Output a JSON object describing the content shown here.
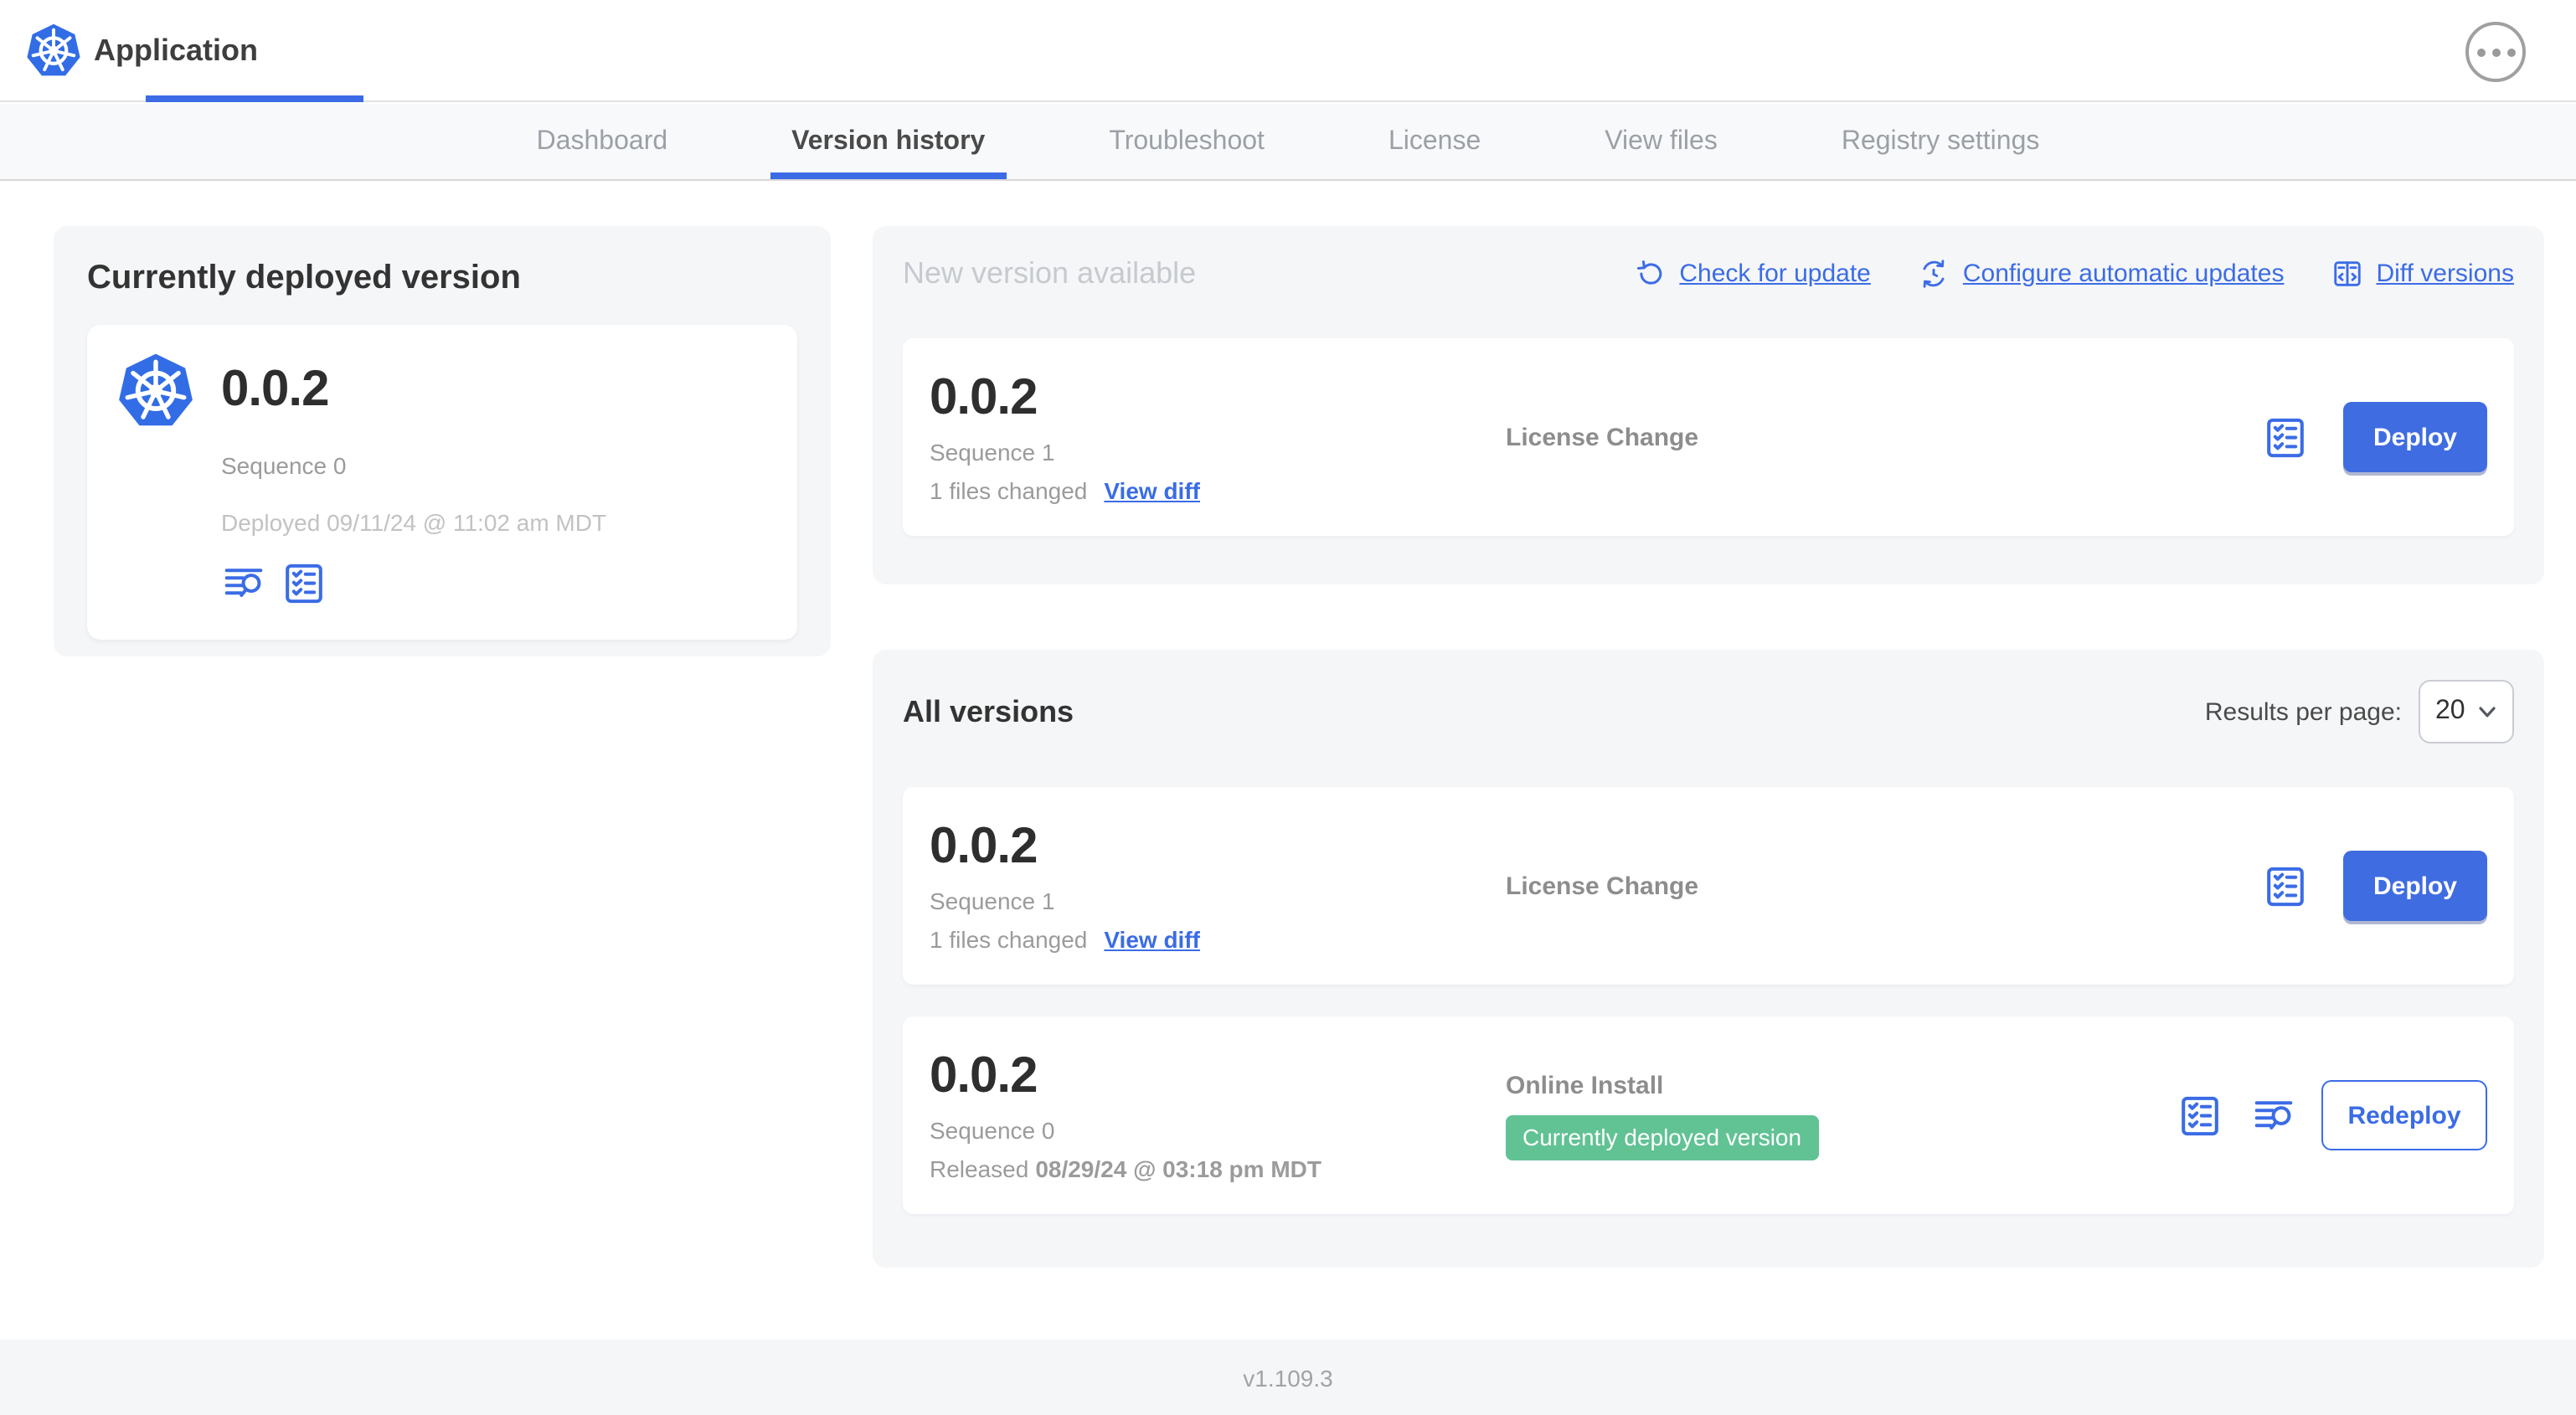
{
  "header": {
    "app_title": "Application",
    "more_menu_icon": "ellipsis-icon"
  },
  "nav": {
    "tabs": [
      {
        "label": "Dashboard",
        "active": false
      },
      {
        "label": "Version history",
        "active": true
      },
      {
        "label": "Troubleshoot",
        "active": false
      },
      {
        "label": "License",
        "active": false
      },
      {
        "label": "View files",
        "active": false
      },
      {
        "label": "Registry settings",
        "active": false
      }
    ]
  },
  "current_version_panel": {
    "title": "Currently deployed version",
    "version": "0.0.2",
    "sequence": "Sequence 0",
    "deployed": "Deployed 09/11/24 @ 11:02 am MDT",
    "icons": [
      "logs-icon",
      "preflight-checklist-icon"
    ]
  },
  "new_version_panel": {
    "title": "New version available",
    "actions": [
      {
        "label": "Check for update",
        "icon": "refresh-icon"
      },
      {
        "label": "Configure automatic updates",
        "icon": "schedule-update-icon"
      },
      {
        "label": "Diff versions",
        "icon": "diff-icon"
      }
    ],
    "card": {
      "version": "0.0.2",
      "sequence": "Sequence 1",
      "files_changed": "1 files changed",
      "view_diff_label": "View diff",
      "source": "License Change",
      "deploy_label": "Deploy",
      "icons": [
        "preflight-checklist-icon"
      ]
    }
  },
  "all_versions_panel": {
    "title": "All versions",
    "results_per_page_label": "Results per page:",
    "results_per_page_value": "20",
    "rows": [
      {
        "version": "0.0.2",
        "sequence": "Sequence 1",
        "files_changed": "1 files changed",
        "view_diff_label": "View diff",
        "source": "License Change",
        "action_label": "Deploy",
        "icons": [
          "preflight-checklist-icon"
        ]
      },
      {
        "version": "0.0.2",
        "sequence": "Sequence 0",
        "released_prefix": "Released",
        "released_date": "08/29/24 @ 03:18 pm MDT",
        "source": "Online Install",
        "badge": "Currently deployed version",
        "action_label": "Redeploy",
        "icons": [
          "preflight-checklist-icon",
          "logs-icon"
        ]
      }
    ]
  },
  "footer": {
    "version": "v1.109.3"
  },
  "colors": {
    "accent_blue": "#3b6ce6",
    "kubernetes_blue": "#326de6",
    "badge_green": "#61c294",
    "panel_gray": "#f5f6f8"
  }
}
